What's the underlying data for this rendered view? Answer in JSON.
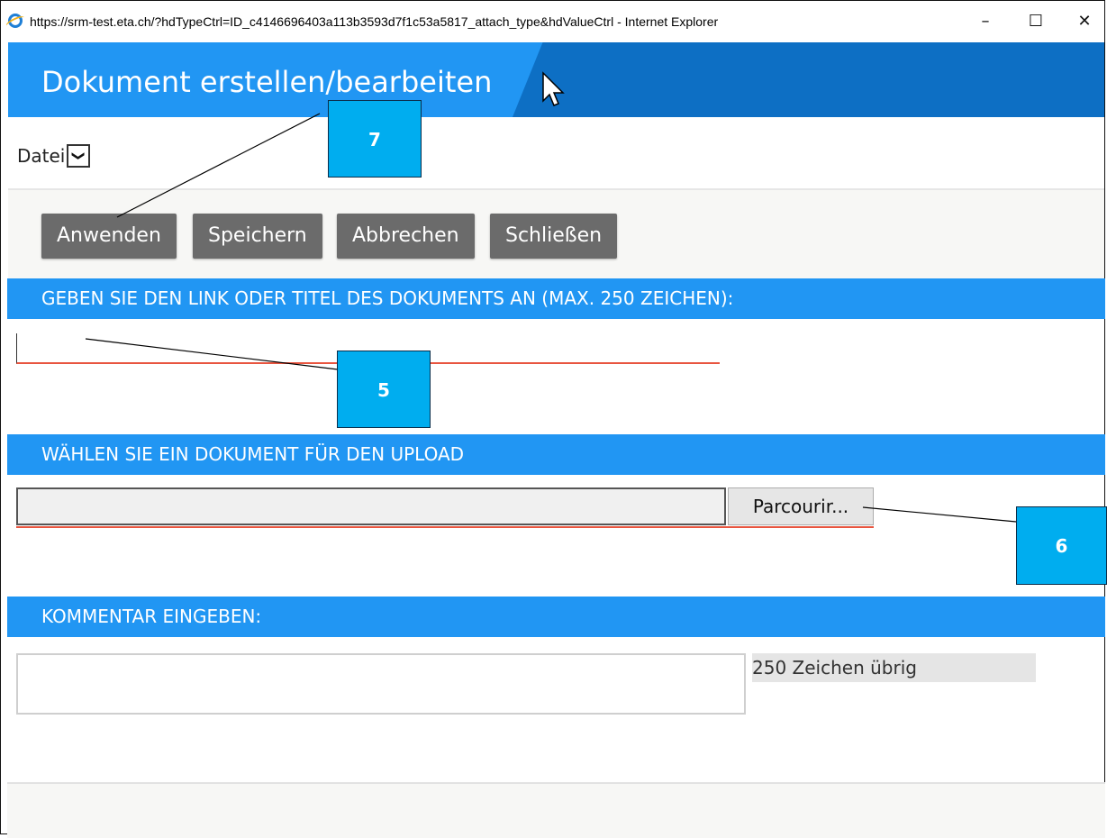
{
  "window": {
    "title": "https://srm-test.eta.ch/?hdTypeCtrl=ID_c4146696403a113b3593d7f1c53a5817_attach_type&hdValueCtrl - Internet Explorer",
    "controls": {
      "minimize": "–",
      "maximize": "☐",
      "close": "✕"
    }
  },
  "header": {
    "title": "Dokument erstellen/bearbeiten"
  },
  "type_select": {
    "value": "Datei",
    "arrow": "❯"
  },
  "toolbar": {
    "apply_label": "Anwenden",
    "save_label": "Speichern",
    "cancel_label": "Abbrechen",
    "close_label": "Schließen"
  },
  "sections": {
    "link_title": "GEBEN SIE DEN LINK ODER TITEL DES DOKUMENTS AN (MAX. 250 ZEICHEN):",
    "upload": "WÄHLEN SIE EIN DOKUMENT FÜR DEN UPLOAD",
    "comment": "KOMMENTAR EINGEBEN:"
  },
  "link_input": {
    "value": ""
  },
  "file_input": {
    "browse_label": "Parcourir..."
  },
  "comment": {
    "chars_left": "250 Zeichen übrig"
  },
  "callouts": {
    "apply": "7",
    "link": "5",
    "browse": "6"
  },
  "colors": {
    "accent": "#2196f3",
    "header_dark": "#0d6fc4",
    "button": "#6b6b6b",
    "callout": "#00adef",
    "error_line": "#e8553f"
  }
}
